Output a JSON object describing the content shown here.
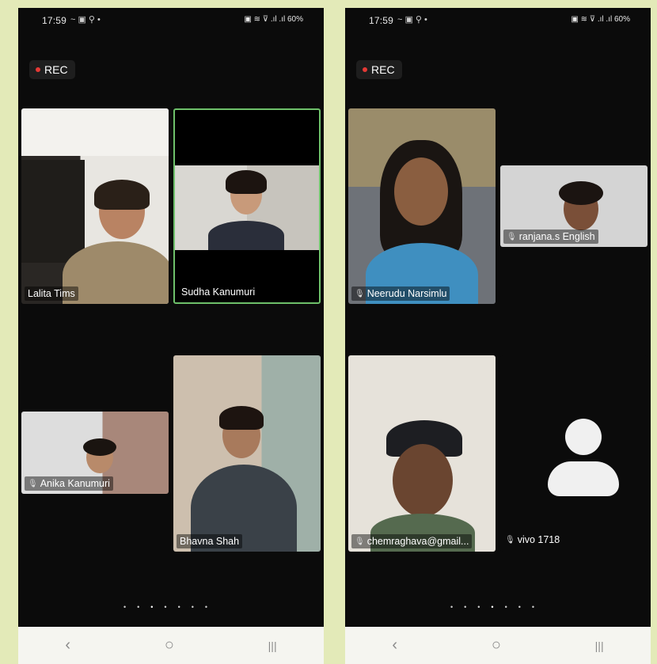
{
  "left_phone": {
    "status": {
      "time": "17:59",
      "icons_left": "~ ▣ ⚲ •",
      "icons_right": "▣ ≋ ⊽ .ıl .ıl 60%"
    },
    "rec_label": "REC",
    "tiles": [
      {
        "name": "Lalita Tims"
      },
      {
        "name": "Sudha Kanumuri"
      },
      {
        "name": "Anika Kanumuri"
      },
      {
        "name": "Bhavna Shah"
      }
    ],
    "page_dots": [
      "•",
      "•",
      "•",
      "•",
      "•",
      "•",
      "•"
    ],
    "nav": {
      "back": "‹",
      "home": "○",
      "recents": "|||"
    }
  },
  "right_phone": {
    "status": {
      "time": "17:59",
      "icons_left": "~ ▣ ⚲ •",
      "icons_right": "▣ ≋ ⊽ .ıl .ıl 60%"
    },
    "rec_label": "REC",
    "tiles": [
      {
        "name": "Neerudu Narsimlu"
      },
      {
        "name": "ranjana.s English"
      },
      {
        "name": "chemraghava@gmail..."
      },
      {
        "name": "vivo 1718"
      }
    ],
    "page_dots": [
      "•",
      "•",
      "•",
      "•",
      "•",
      "•",
      "•"
    ],
    "nav": {
      "back": "‹",
      "home": "○",
      "recents": "|||"
    }
  },
  "colors": {
    "background": "#e3eab8",
    "screen": "#0b0b0b",
    "active_speaker_border": "#6ec06a",
    "rec_dot": "#e53935"
  },
  "icons": {
    "mic": "mic-icon",
    "avatar_placeholder": "person-icon"
  }
}
